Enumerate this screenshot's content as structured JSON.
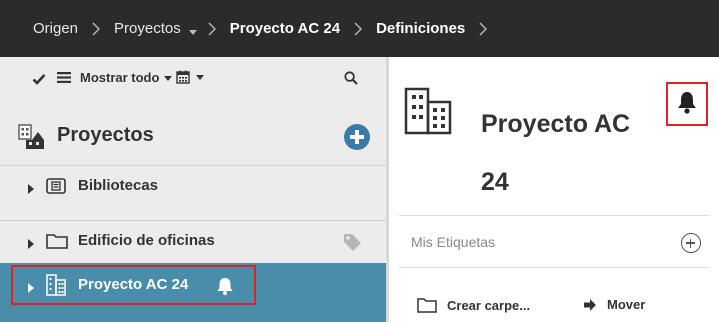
{
  "breadcrumb": {
    "items": [
      {
        "label": "Origen"
      },
      {
        "label": "Proyectos"
      },
      {
        "label": "Proyecto AC 24"
      },
      {
        "label": "Definiciones"
      }
    ]
  },
  "toolbar": {
    "show_all_label": "Mostrar todo",
    "icons": [
      "checkmark-icon",
      "list-icon",
      "calendar-icon",
      "search-icon"
    ]
  },
  "tree": {
    "title": "Proyectos",
    "items": [
      {
        "label": "Bibliotecas",
        "icon": "library-icon"
      },
      {
        "label": "Edificio de oficinas",
        "icon": "folder-icon"
      },
      {
        "label": "Proyecto AC 24",
        "icon": "building-icon",
        "selected": true
      }
    ]
  },
  "details": {
    "title": "Proyecto AC 24",
    "tags_label": "Mis Etiquetas",
    "actions": [
      {
        "label": "Crear carpe...",
        "icon": "folder-icon"
      },
      {
        "label": "Mover",
        "icon": "arrow-right-icon"
      }
    ]
  },
  "colors": {
    "topbar": "#2b2b2b",
    "sidebar": "#ececec",
    "selected_row": "#4a8dab",
    "accent": "#3a7ba8",
    "highlight_border": "#e0202a"
  }
}
